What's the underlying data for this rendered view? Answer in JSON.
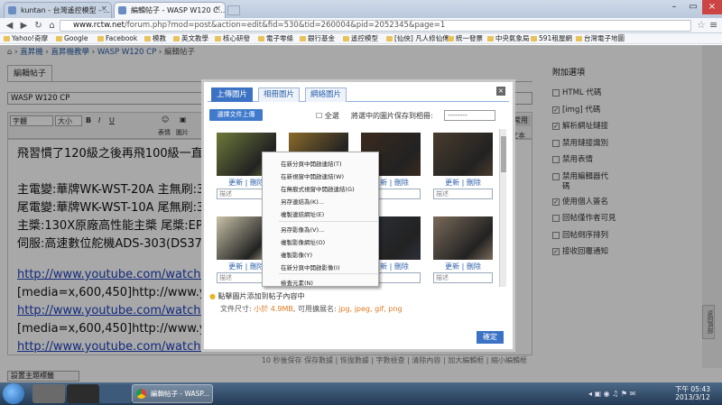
{
  "browser": {
    "tabs": [
      {
        "label": "kuntan - 台灣遙控模型 - ..."
      },
      {
        "label": "編輯帖子 - WASP W120 C..."
      }
    ],
    "url_host": "www.rctw.net",
    "url_path": "/forum.php?mod=post&action=edit&fid=530&tid=260004&pid=2052345&page=1",
    "bookmarks": [
      "Yahoo!奇摩",
      "Google",
      "Facebook",
      "模教",
      "英文教學",
      "核心研發",
      "電子零條",
      "銀行基金",
      "遙控模型",
      "[仙俠] 凡人修仙傳",
      "統一發票",
      "中央氣象局",
      "591租屋網",
      "台灣電子地圖"
    ]
  },
  "breadcrumb": {
    "items": [
      "直昇機",
      "直昇機教學",
      "WASP W120 CP",
      "編輯帖子"
    ]
  },
  "editor": {
    "tab_label": "編輯帖子",
    "subject": "WASP W120 CP",
    "font_select": "字體",
    "size_select": "大小",
    "toolbar_labels": [
      "表情",
      "圖片"
    ],
    "mode_label": "文本",
    "common_label": "常用",
    "lines": [
      {
        "text": "飛習慣了120級之後再飛100級一直無法",
        "link": false
      },
      {
        "text": "",
        "link": false
      },
      {
        "text": "主電變:華牌WK-WST-20A     主無刷:3",
        "link": false
      },
      {
        "text": "尾電變:華牌WK-WST-10A     尾無刷:3",
        "link": false
      },
      {
        "text": "主槳:130X原廠高性能主槳     尾槳:EP3",
        "link": false
      },
      {
        "text": "伺服:高速數位舵機ADS-303(DS37)+SS",
        "link": false
      },
      {
        "text": "",
        "link": false
      },
      {
        "text": "http://www.youtube.com/watch?v=Ls",
        "link": true
      },
      {
        "text": "[media=x,600,450]http://www.youtub",
        "link": false
      },
      {
        "text": "http://www.youtube.com/watch?v=O9",
        "link": true
      },
      {
        "text": "[media=x,600,450]http://www.youtub",
        "link": false
      },
      {
        "text": "http://www.youtube.com/watch?v=ZK",
        "link": true
      }
    ],
    "status_bar": "10 秒後保存 保存數據 | 恢復數據 | 字數檢查 | 清除內容 | 加大編輯框 | 縮小編輯框",
    "topic_button": "設置主題標籤"
  },
  "sidebar": {
    "title": "附加選項",
    "options": [
      {
        "label": "HTML 代碼",
        "checked": false
      },
      {
        "label": "[img] 代碼",
        "checked": true
      },
      {
        "label": "解析網址鏈接",
        "checked": true
      },
      {
        "label": "禁用鏈接識別",
        "checked": false
      },
      {
        "label": "禁用表情",
        "checked": false
      },
      {
        "label": "禁用編輯器代碼",
        "checked": false
      },
      {
        "label": "使用個人簽名",
        "checked": true
      },
      {
        "label": "回帖僅作者可見",
        "checked": false
      },
      {
        "label": "回帖倒序排列",
        "checked": false
      },
      {
        "label": "接收回覆通知",
        "checked": true
      }
    ],
    "side_dock": "返回頂部"
  },
  "dialog": {
    "tabs": [
      "上傳圖片",
      "相冊圖片",
      "網絡圖片"
    ],
    "select_button": "選擇文件上傳",
    "select_all": "全選",
    "save_to_album": "將選中的圖片保存到相冊:",
    "album_select": "--------",
    "photos": [
      {
        "edit": "更新",
        "delete": "刪除",
        "desc": "描述",
        "color": "#6d7a3a"
      },
      {
        "edit": "更新",
        "delete": "刪除",
        "desc": "描述",
        "color": "#8a6a2a"
      },
      {
        "edit": "更新",
        "delete": "刪除",
        "desc": "描述",
        "color": "#3b2a1e"
      },
      {
        "edit": "更新",
        "delete": "刪除",
        "desc": "描述",
        "color": "#4a3c2e"
      },
      {
        "edit": "更新",
        "delete": "刪除",
        "desc": "描述",
        "color": "#c9c2a8"
      },
      {
        "edit": "更新",
        "delete": "刪除",
        "desc": "描述",
        "color": "#5a4a30"
      },
      {
        "edit": "更新",
        "delete": "刪除",
        "desc": "描述",
        "color": "#2c3038"
      },
      {
        "edit": "更新",
        "delete": "刪除",
        "desc": "描述",
        "color": "#7a6a5a"
      }
    ],
    "tip": "點擊圖片添加到帖子內容中",
    "size_prefix": "文件尺寸:",
    "size_value": "小於 4.9MB",
    "ext_prefix": ", 可用擴展名:",
    "ext_values": "jpg, jpeg, gif, png",
    "confirm": "確定"
  },
  "context_menu": {
    "items": [
      "在新分頁中開啟連結(T)",
      "在新視窗中開啟連結(W)",
      "在無痕式視窗中開啟連結(G)",
      "另存連結為(K)...",
      "複製連結網址(E)",
      "另存影像為(V)...",
      "複製影像網址(O)",
      "複製影像(Y)",
      "在新分頁中開啟影像(I)",
      "檢查元素(N)"
    ]
  },
  "taskbar": {
    "chrome_label": "編輯帖子 - WASP...",
    "time": "下午 05:43",
    "date": "2013/3/12"
  }
}
